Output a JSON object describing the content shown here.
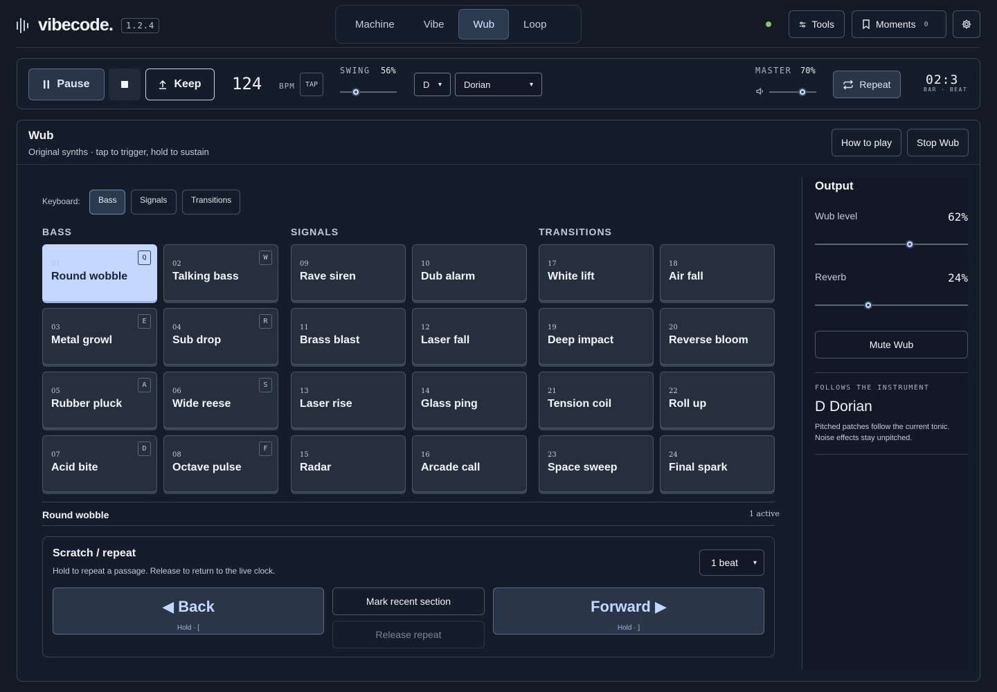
{
  "app": {
    "name": "vibecode.",
    "version": "1.2.4"
  },
  "modes": [
    "Machine",
    "Vibe",
    "Wub",
    "Loop"
  ],
  "active_mode": "Wub",
  "header": {
    "tools_label": "Tools",
    "moments_label": "Moments",
    "moments_count": "0"
  },
  "transport": {
    "pause_label": "Pause",
    "keep_label": "Keep",
    "bpm_value": "124",
    "bpm_label": "BPM",
    "tap_label": "TAP",
    "swing_label": "SWING",
    "swing_value": "56%",
    "swing_level": 0.28,
    "key_value": "D",
    "scale_value": "Dorian",
    "master_label": "MASTER",
    "master_value": "70%",
    "master_level": 0.7,
    "repeat_label": "Repeat",
    "clock": "02:3",
    "clock_sub": "BAR · BEAT"
  },
  "panel": {
    "title": "Wub",
    "subtitle": "Original synths · tap to trigger, hold to sustain",
    "how_to_play": "How to play",
    "stop": "Stop Wub"
  },
  "keyboard": {
    "label": "Keyboard:",
    "tabs": [
      "Bass",
      "Signals",
      "Transitions"
    ],
    "active": "Bass"
  },
  "groups": [
    {
      "title": "BASS",
      "pads": [
        {
          "num": "01",
          "name": "Round wobble",
          "key": "Q",
          "active": true
        },
        {
          "num": "02",
          "name": "Talking bass",
          "key": "W"
        },
        {
          "num": "03",
          "name": "Metal growl",
          "key": "E"
        },
        {
          "num": "04",
          "name": "Sub drop",
          "key": "R"
        },
        {
          "num": "05",
          "name": "Rubber pluck",
          "key": "A"
        },
        {
          "num": "06",
          "name": "Wide reese",
          "key": "S"
        },
        {
          "num": "07",
          "name": "Acid bite",
          "key": "D"
        },
        {
          "num": "08",
          "name": "Octave pulse",
          "key": "F"
        }
      ]
    },
    {
      "title": "SIGNALS",
      "pads": [
        {
          "num": "09",
          "name": "Rave siren"
        },
        {
          "num": "10",
          "name": "Dub alarm"
        },
        {
          "num": "11",
          "name": "Brass blast"
        },
        {
          "num": "12",
          "name": "Laser fall"
        },
        {
          "num": "13",
          "name": "Laser rise"
        },
        {
          "num": "14",
          "name": "Glass ping"
        },
        {
          "num": "15",
          "name": "Radar"
        },
        {
          "num": "16",
          "name": "Arcade call"
        }
      ]
    },
    {
      "title": "TRANSITIONS",
      "pads": [
        {
          "num": "17",
          "name": "White lift"
        },
        {
          "num": "18",
          "name": "Air fall"
        },
        {
          "num": "19",
          "name": "Deep impact"
        },
        {
          "num": "20",
          "name": "Reverse bloom"
        },
        {
          "num": "21",
          "name": "Tension coil"
        },
        {
          "num": "22",
          "name": "Roll up"
        },
        {
          "num": "23",
          "name": "Space sweep"
        },
        {
          "num": "24",
          "name": "Final spark"
        }
      ]
    }
  ],
  "selection": {
    "name": "Round wobble",
    "count": "1 active"
  },
  "scratch": {
    "title": "Scratch / repeat",
    "subtitle": "Hold to repeat a passage. Release to return to the live clock.",
    "beat_option": "1 beat",
    "back_label": "◀ Back",
    "back_hint": "Hold · [",
    "forward_label": "Forward ▶",
    "forward_hint": "Hold · ]",
    "mark_label": "Mark recent section",
    "release_label": "Release repeat"
  },
  "output": {
    "title": "Output",
    "wub_level_label": "Wub level",
    "wub_level_value": "62%",
    "wub_level": 0.62,
    "reverb_label": "Reverb",
    "reverb_value": "24%",
    "reverb_level": 0.35,
    "mute_label": "Mute Wub",
    "follows_label": "FOLLOWS THE INSTRUMENT",
    "key_name": "D Dorian",
    "note": "Pitched patches follow the current tonic. Noise effects stay unpitched."
  },
  "colors": {
    "background": "#131a26",
    "accent": "#c4d7ff",
    "status_dot": "#8cc56a"
  },
  "icons": [
    "waveform-logo-icon",
    "sliders-icon",
    "bookmark-icon",
    "gear-icon",
    "pause-icon",
    "stop-icon",
    "upload-icon",
    "volume-icon",
    "repeat-icon",
    "chevron-down-icon"
  ]
}
